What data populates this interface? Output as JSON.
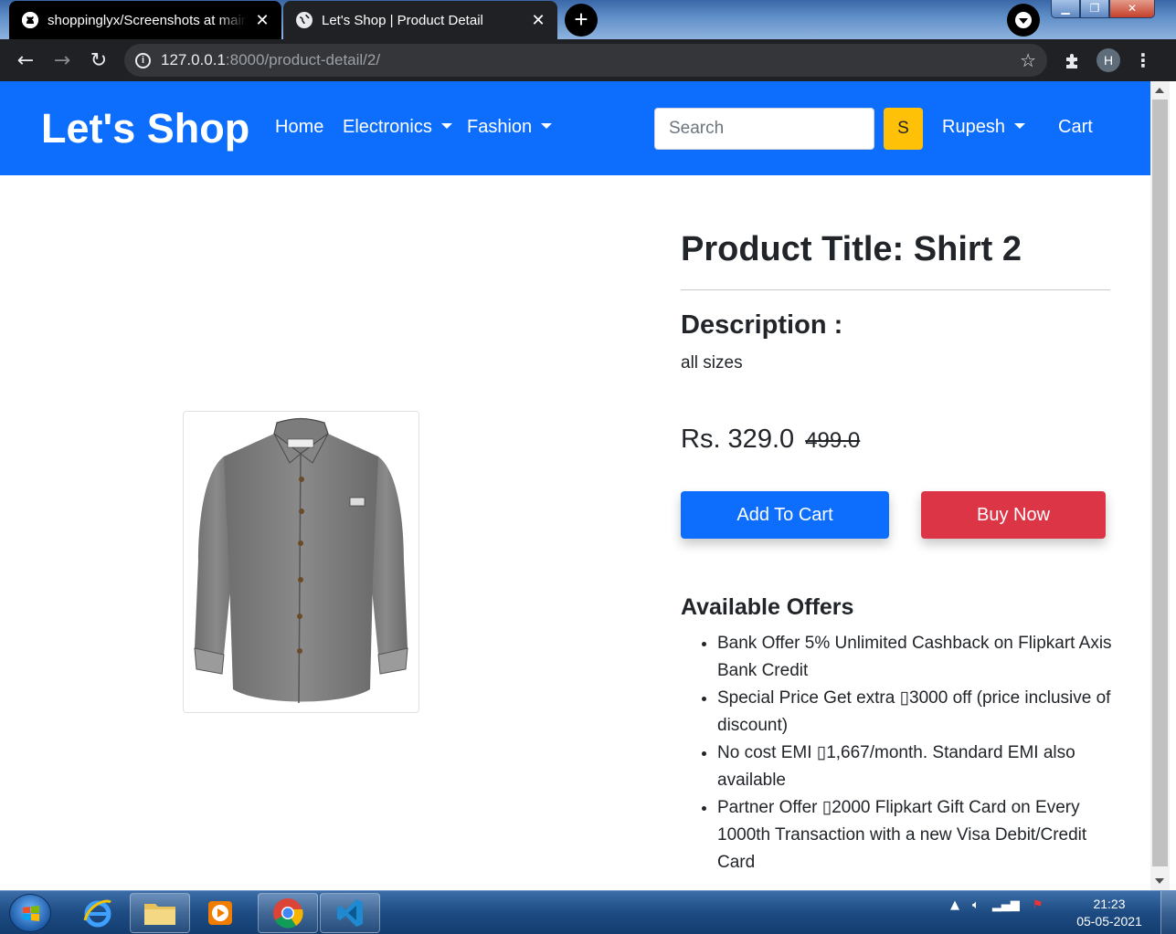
{
  "browser": {
    "tabs": [
      {
        "title": "shoppinglyx/Screenshots at main",
        "active": false
      },
      {
        "title": "Let's Shop | Product Detail",
        "active": true
      }
    ],
    "new_tab": "+",
    "url_host": "127.0.0.1",
    "url_path": ":8000/product-detail/2/",
    "profile_initial": "H"
  },
  "navbar": {
    "brand": "Let's Shop",
    "links": [
      "Home",
      "Electronics",
      "Fashion"
    ],
    "search_placeholder": "Search",
    "search_button": "S",
    "user": "Rupesh",
    "cart": "Cart"
  },
  "product": {
    "title": "Product Title: Shirt 2",
    "description_heading": "Description :",
    "description": "all sizes",
    "price": "Rs. 329.0",
    "old_price": "499.0",
    "add_to_cart": "Add To Cart",
    "buy_now": "Buy Now",
    "offers_heading": "Available Offers",
    "offers": [
      "Bank Offer 5% Unlimited Cashback on Flipkart Axis Bank Credit",
      "Special Price Get extra ▯3000 off (price inclusive of discount)",
      "No cost EMI ▯1,667/month. Standard EMI also available",
      "Partner Offer ▯2000 Flipkart Gift Card on Every 1000th Transaction with a new Visa Debit/Credit Card"
    ],
    "image_icon": "shirt-image"
  },
  "taskbar": {
    "time": "21:23",
    "date": "05-05-2021"
  },
  "colors": {
    "navbar_bg": "#0d6efd",
    "search_button_bg": "#ffc107",
    "add_to_cart_bg": "#0d6efd",
    "buy_now_bg": "#dc3545"
  }
}
